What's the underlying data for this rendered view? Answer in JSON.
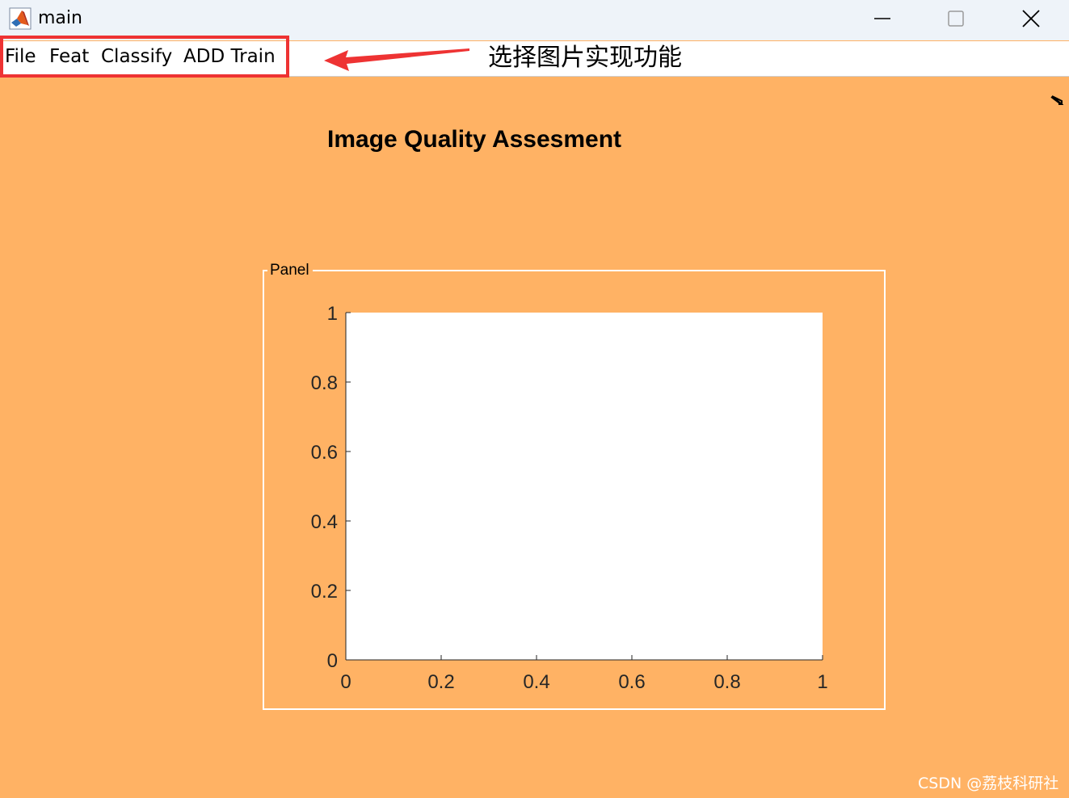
{
  "window": {
    "title": "main"
  },
  "menubar": {
    "items": [
      {
        "label": "File"
      },
      {
        "label": "Feat"
      },
      {
        "label": "Classify"
      },
      {
        "label": "ADD Train"
      }
    ]
  },
  "annotation": {
    "text": "选择图片实现功能",
    "color": "#ee3333"
  },
  "main": {
    "title": "Image Quality Assesment",
    "background_color": "#ffb264"
  },
  "panel": {
    "title": "Panel"
  },
  "chart_data": {
    "type": "line",
    "title": "",
    "xlabel": "",
    "ylabel": "",
    "xlim": [
      0,
      1
    ],
    "ylim": [
      0,
      1
    ],
    "xticks": [
      0,
      0.2,
      0.4,
      0.6,
      0.8,
      1
    ],
    "yticks": [
      0,
      0.2,
      0.4,
      0.6,
      0.8,
      1
    ],
    "xtick_labels": [
      "0",
      "0.2",
      "0.4",
      "0.6",
      "0.8",
      "1"
    ],
    "ytick_labels": [
      "0",
      "0.2",
      "0.4",
      "0.6",
      "0.8",
      "1"
    ],
    "series": [],
    "grid": false
  },
  "watermark": {
    "text": "CSDN @荔枝科研社"
  }
}
